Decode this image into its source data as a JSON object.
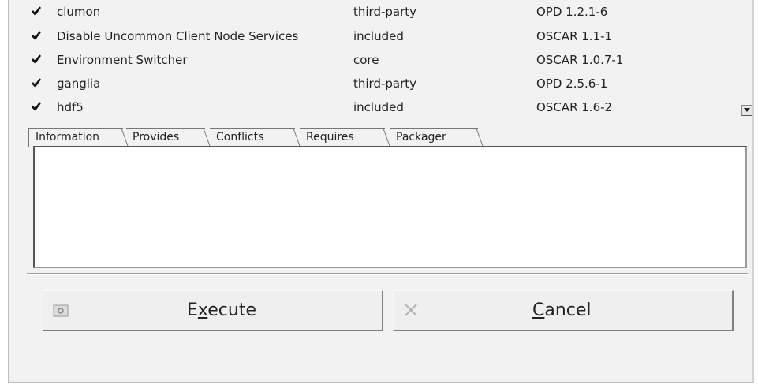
{
  "packages": [
    {
      "name": "clumon",
      "class": "third-party",
      "version": "OPD 1.2.1-6",
      "checked": true
    },
    {
      "name": "Disable Uncommon Client Node Services",
      "class": "included",
      "version": "OSCAR 1.1-1",
      "checked": true
    },
    {
      "name": "Environment Switcher",
      "class": "core",
      "version": "OSCAR 1.0.7-1",
      "checked": true
    },
    {
      "name": "ganglia",
      "class": "third-party",
      "version": "OPD 2.5.6-1",
      "checked": true
    },
    {
      "name": "hdf5",
      "class": "included",
      "version": "OSCAR 1.6-2",
      "checked": true
    }
  ],
  "tabs": [
    {
      "label": "Information",
      "active": true
    },
    {
      "label": "Provides",
      "active": false
    },
    {
      "label": "Conflicts",
      "active": false
    },
    {
      "label": "Requires",
      "active": false
    },
    {
      "label": "Packager",
      "active": false
    }
  ],
  "buttons": {
    "execute_pre": "E",
    "execute_mnemonic": "x",
    "execute_post": "ecute",
    "execute_icon": "execute-icon",
    "cancel_mnemonic": "C",
    "cancel_post": "ancel",
    "cancel_icon": "close-icon"
  },
  "colors": {
    "window_bg": "#f2f2f2",
    "panel_bg": "#ffffff",
    "border_dark": "#555555"
  }
}
